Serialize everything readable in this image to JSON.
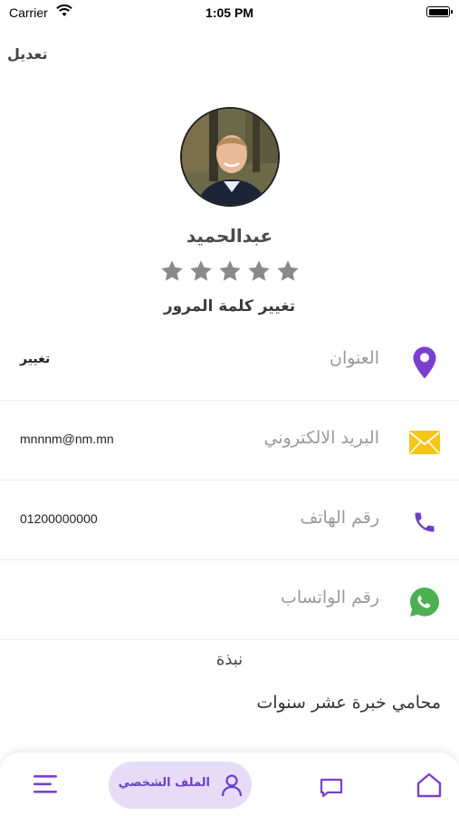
{
  "status_bar": {
    "carrier": "Carrier",
    "time": "1:05 PM"
  },
  "header": {
    "edit_label": "تعديل"
  },
  "profile": {
    "name": "عبدالحميد",
    "rating": {
      "value": 0,
      "max": 5
    },
    "change_password_label": "تغيير كلمة المرور"
  },
  "fields": [
    {
      "label": "العنوان",
      "value": "تغيير",
      "icon": "location-pin-icon"
    },
    {
      "label": "البريد الالكتروني",
      "value": "mnnnm@nm.mn",
      "icon": "envelope-icon"
    },
    {
      "label": "رقم الهاتف",
      "value": "01200000000",
      "icon": "phone-icon"
    },
    {
      "label": "رقم الواتساب",
      "value": "",
      "icon": "whatsapp-icon"
    }
  ],
  "bio": {
    "title": "نبذة",
    "text": "محامي خبرة عشر سنوات"
  },
  "bottom_nav": {
    "items": [
      {
        "icon": "home-icon"
      },
      {
        "icon": "chat-icon"
      },
      {
        "icon": "user-icon",
        "label": "الملف الشخصي",
        "active": true
      },
      {
        "icon": "menu-icon"
      }
    ]
  },
  "colors": {
    "accent": "#6b3fc6",
    "active_nav_bg": "#e7dcf8",
    "star": "#8a8a8a",
    "envelope": "#f5c518",
    "whatsapp": "#4caf50"
  }
}
